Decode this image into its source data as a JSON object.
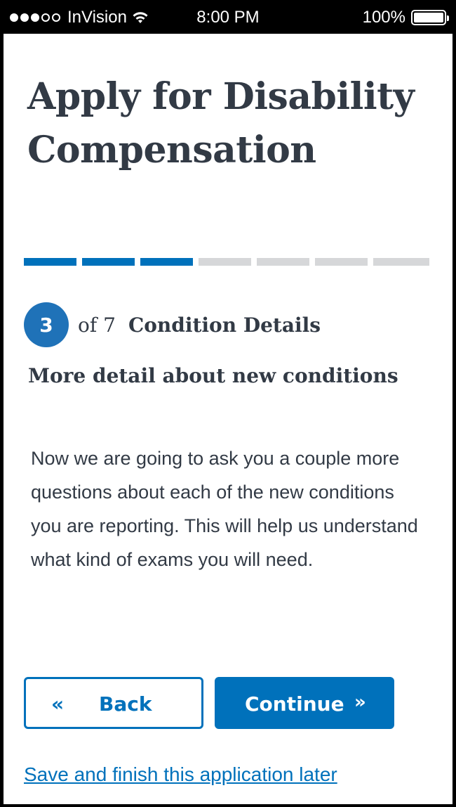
{
  "status_bar": {
    "carrier": "InVision",
    "time": "8:00 PM",
    "battery": "100%"
  },
  "page": {
    "title": "Apply for Disability Compensation"
  },
  "progress": {
    "total_segments": 7,
    "completed_segments": 3,
    "active_color": "#0071bb",
    "inactive_color": "#d6d7d9"
  },
  "step": {
    "number": "3",
    "of_label": "of 7",
    "title": "Condition Details"
  },
  "section": {
    "heading": "More detail about new conditions",
    "body": "Now we are going to ask you a couple more questions about each of the new conditions you are reporting. This will help us understand what kind of exams you will need."
  },
  "actions": {
    "back_label": "Back",
    "back_icon": "«",
    "continue_label": "Continue",
    "continue_icon": "»",
    "save_link": "Save and finish this application later"
  },
  "colors": {
    "primary": "#0071bb",
    "text": "#323a45"
  }
}
